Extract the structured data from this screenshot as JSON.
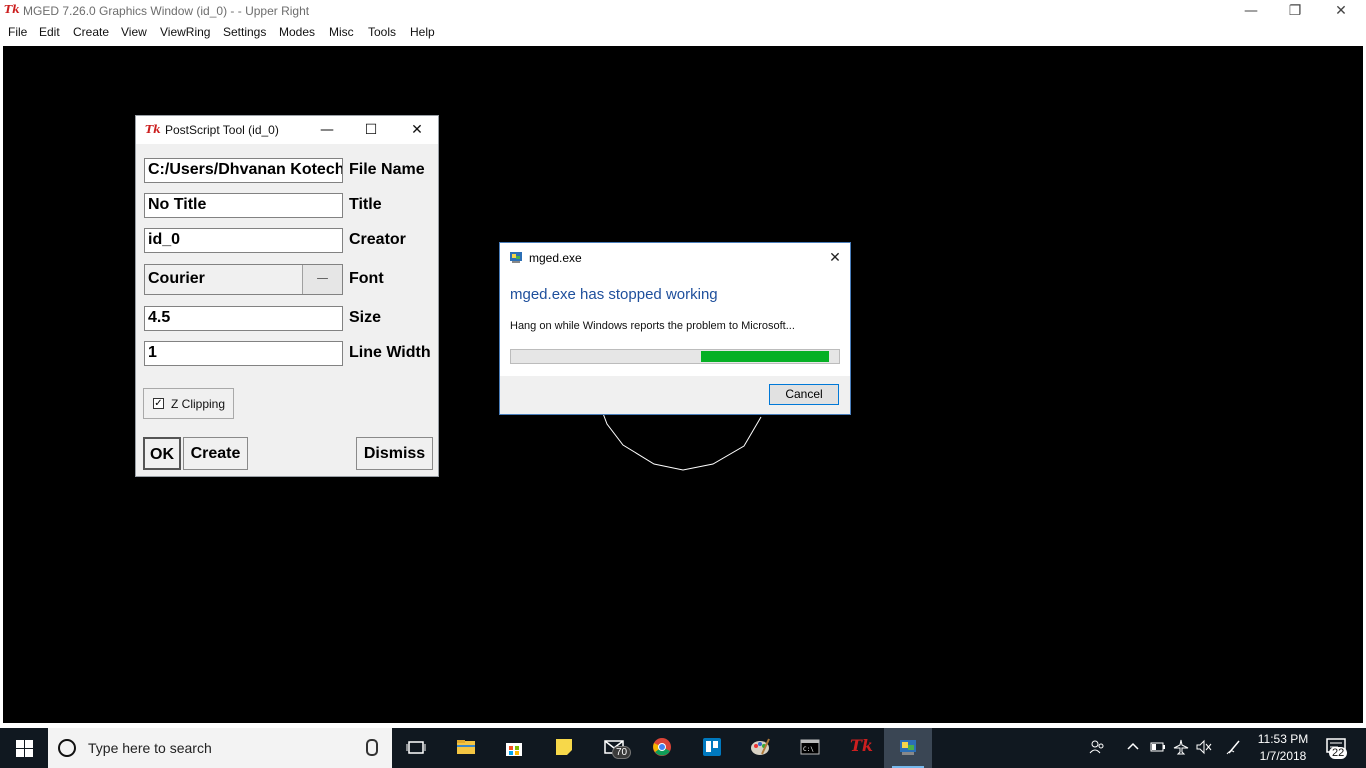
{
  "main_window": {
    "title": "MGED 7.26.0 Graphics Window (id_0) -  - Upper Right",
    "icon": "tk-feather-icon",
    "controls": {
      "minimize": "—",
      "restore": "❐",
      "close": "✕"
    }
  },
  "menubar": {
    "items": [
      "File",
      "Edit",
      "Create",
      "View",
      "ViewRing",
      "Settings",
      "Modes",
      "Misc",
      "Tools",
      "Help"
    ]
  },
  "postscript_tool": {
    "title": "PostScript Tool (id_0)",
    "controls": {
      "minimize": "—",
      "maximize": "☐",
      "close": "✕"
    },
    "fields": [
      {
        "label": "File Name",
        "value": "C:/Users/Dhvanan Kotecha"
      },
      {
        "label": "Title",
        "value": "No Title"
      },
      {
        "label": "Creator",
        "value": "id_0"
      },
      {
        "label": "Size",
        "value": "4.5"
      },
      {
        "label": "Line Width",
        "value": "1"
      }
    ],
    "font": {
      "label": "Font",
      "value": "Courier",
      "arrow": "—"
    },
    "z_clipping": {
      "label": "Z Clipping",
      "checked": true,
      "check_mark": "✓"
    },
    "buttons": {
      "ok": "OK",
      "create": "Create",
      "dismiss": "Dismiss"
    }
  },
  "error_dialog": {
    "title": "mged.exe",
    "close": "✕",
    "heading": "mged.exe has stopped working",
    "message": "Hang on while Windows reports the problem to Microsoft...",
    "progress": {
      "indeterminate": true,
      "segment_start": 0.58,
      "segment_end": 0.97
    },
    "cancel": "Cancel",
    "accent_color": "#06b025"
  },
  "taskbar": {
    "search_placeholder": "Type here to search",
    "mail_badge": "70",
    "clock_time": "11:53 PM",
    "clock_date": "1/7/2018",
    "notification_count": "22",
    "apps": [
      "task-view",
      "file-explorer",
      "store",
      "sticky-notes",
      "mail",
      "chrome",
      "trello",
      "paint",
      "terminal",
      "tk-wish",
      "mged"
    ]
  }
}
